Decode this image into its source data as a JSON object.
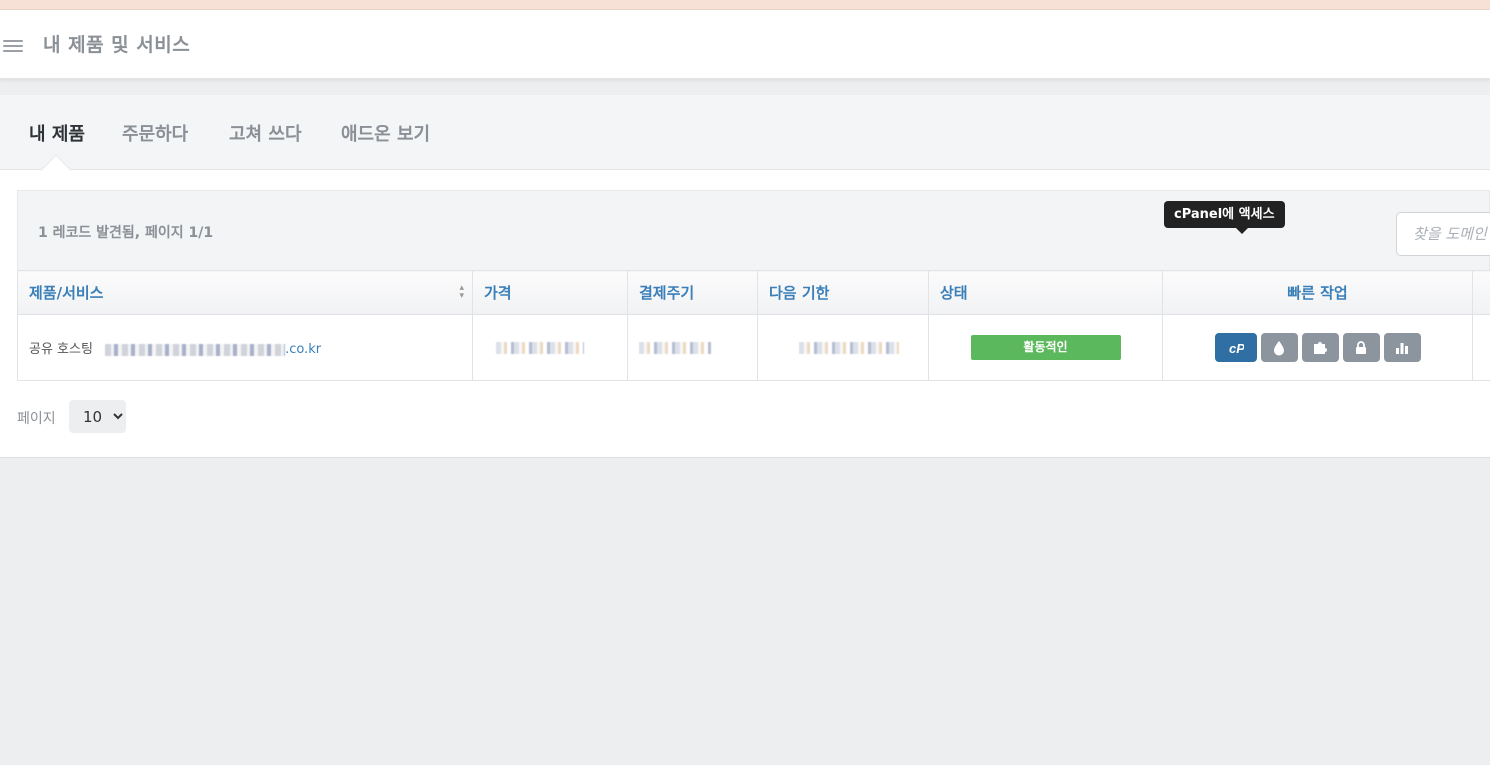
{
  "header": {
    "title": "내 제품 및 서비스",
    "menu_icon": "hamburger-icon"
  },
  "tabs": [
    {
      "label": "내 제품",
      "active": true
    },
    {
      "label": "주문하다",
      "active": false
    },
    {
      "label": "고쳐 쓰다",
      "active": false
    },
    {
      "label": "애드온 보기",
      "active": false
    }
  ],
  "toolbar": {
    "record_info": "1 레코드 발견됨, 페이지 1/1",
    "search_placeholder": "찾을 도메인"
  },
  "table": {
    "columns": [
      "제품/서비스",
      "가격",
      "결제주기",
      "다음 기한",
      "상태",
      "빠른 작업"
    ],
    "rows": [
      {
        "product_group": "공유 호스팅",
        "domain_suffix": ".co.kr",
        "status": "활동적인"
      }
    ]
  },
  "quick_actions": [
    {
      "name": "cpanel-icon",
      "label": "cP",
      "primary": true
    },
    {
      "name": "drop-icon",
      "primary": false
    },
    {
      "name": "puzzle-icon",
      "primary": false
    },
    {
      "name": "lock-icon",
      "primary": false
    },
    {
      "name": "bar-chart-icon",
      "primary": false
    }
  ],
  "tooltip": "cPanel에 액세스",
  "pager": {
    "label": "페이지",
    "selected": "10"
  },
  "colors": {
    "link": "#3a7fb8",
    "active_status": "#5cb85c",
    "primary_action": "#2f6fa4",
    "action_grey": "#8c959e"
  }
}
